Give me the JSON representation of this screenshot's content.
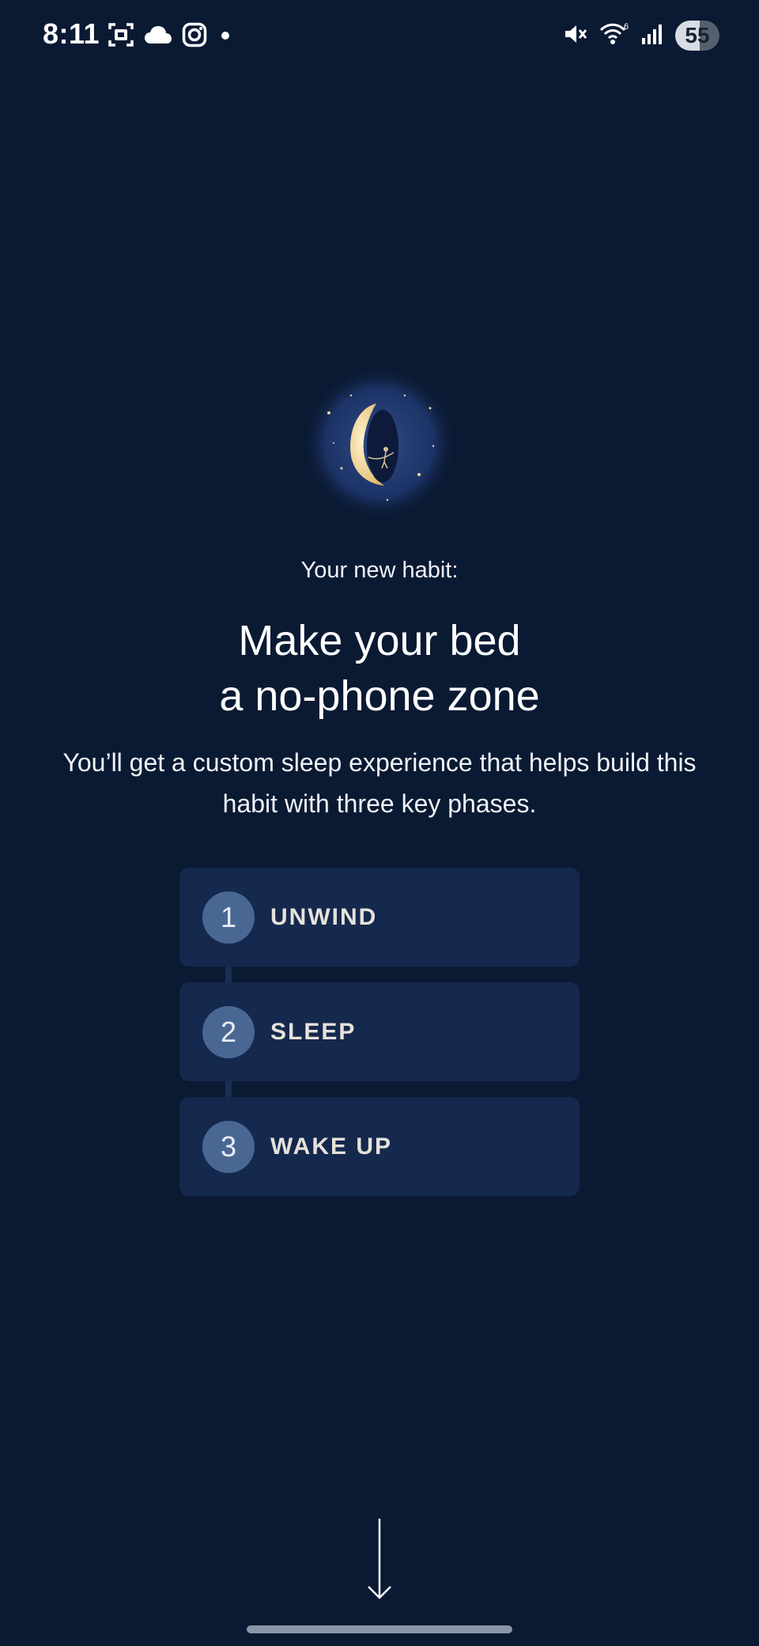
{
  "status_bar": {
    "time": "8:11",
    "left_icons": [
      "screenshot-icon",
      "cloud-icon",
      "instagram-icon",
      "notification-dot-icon"
    ],
    "right_icons": [
      "mute-icon",
      "wifi-icon",
      "signal-icon"
    ],
    "wifi_badge": "6",
    "battery_level": "55",
    "battery_fill_fraction": 0.55
  },
  "illustration": {
    "icon": "moon-illustration-icon"
  },
  "intro": {
    "eyebrow": "Your new habit:",
    "headline_line1": "Make your bed",
    "headline_line2": "a no-phone zone",
    "description": "You’ll get a custom sleep experience that helps build this habit with three key phases."
  },
  "phases": [
    {
      "number": "1",
      "label": "UNWIND"
    },
    {
      "number": "2",
      "label": "SLEEP"
    },
    {
      "number": "3",
      "label": "WAKE UP"
    }
  ],
  "scroll_hint": {
    "icon": "down-arrow-icon"
  },
  "colors": {
    "background": "#0b1a33",
    "card": "#15284d",
    "number_badge": "#4a6794",
    "phase_text": "#e6e2da"
  }
}
